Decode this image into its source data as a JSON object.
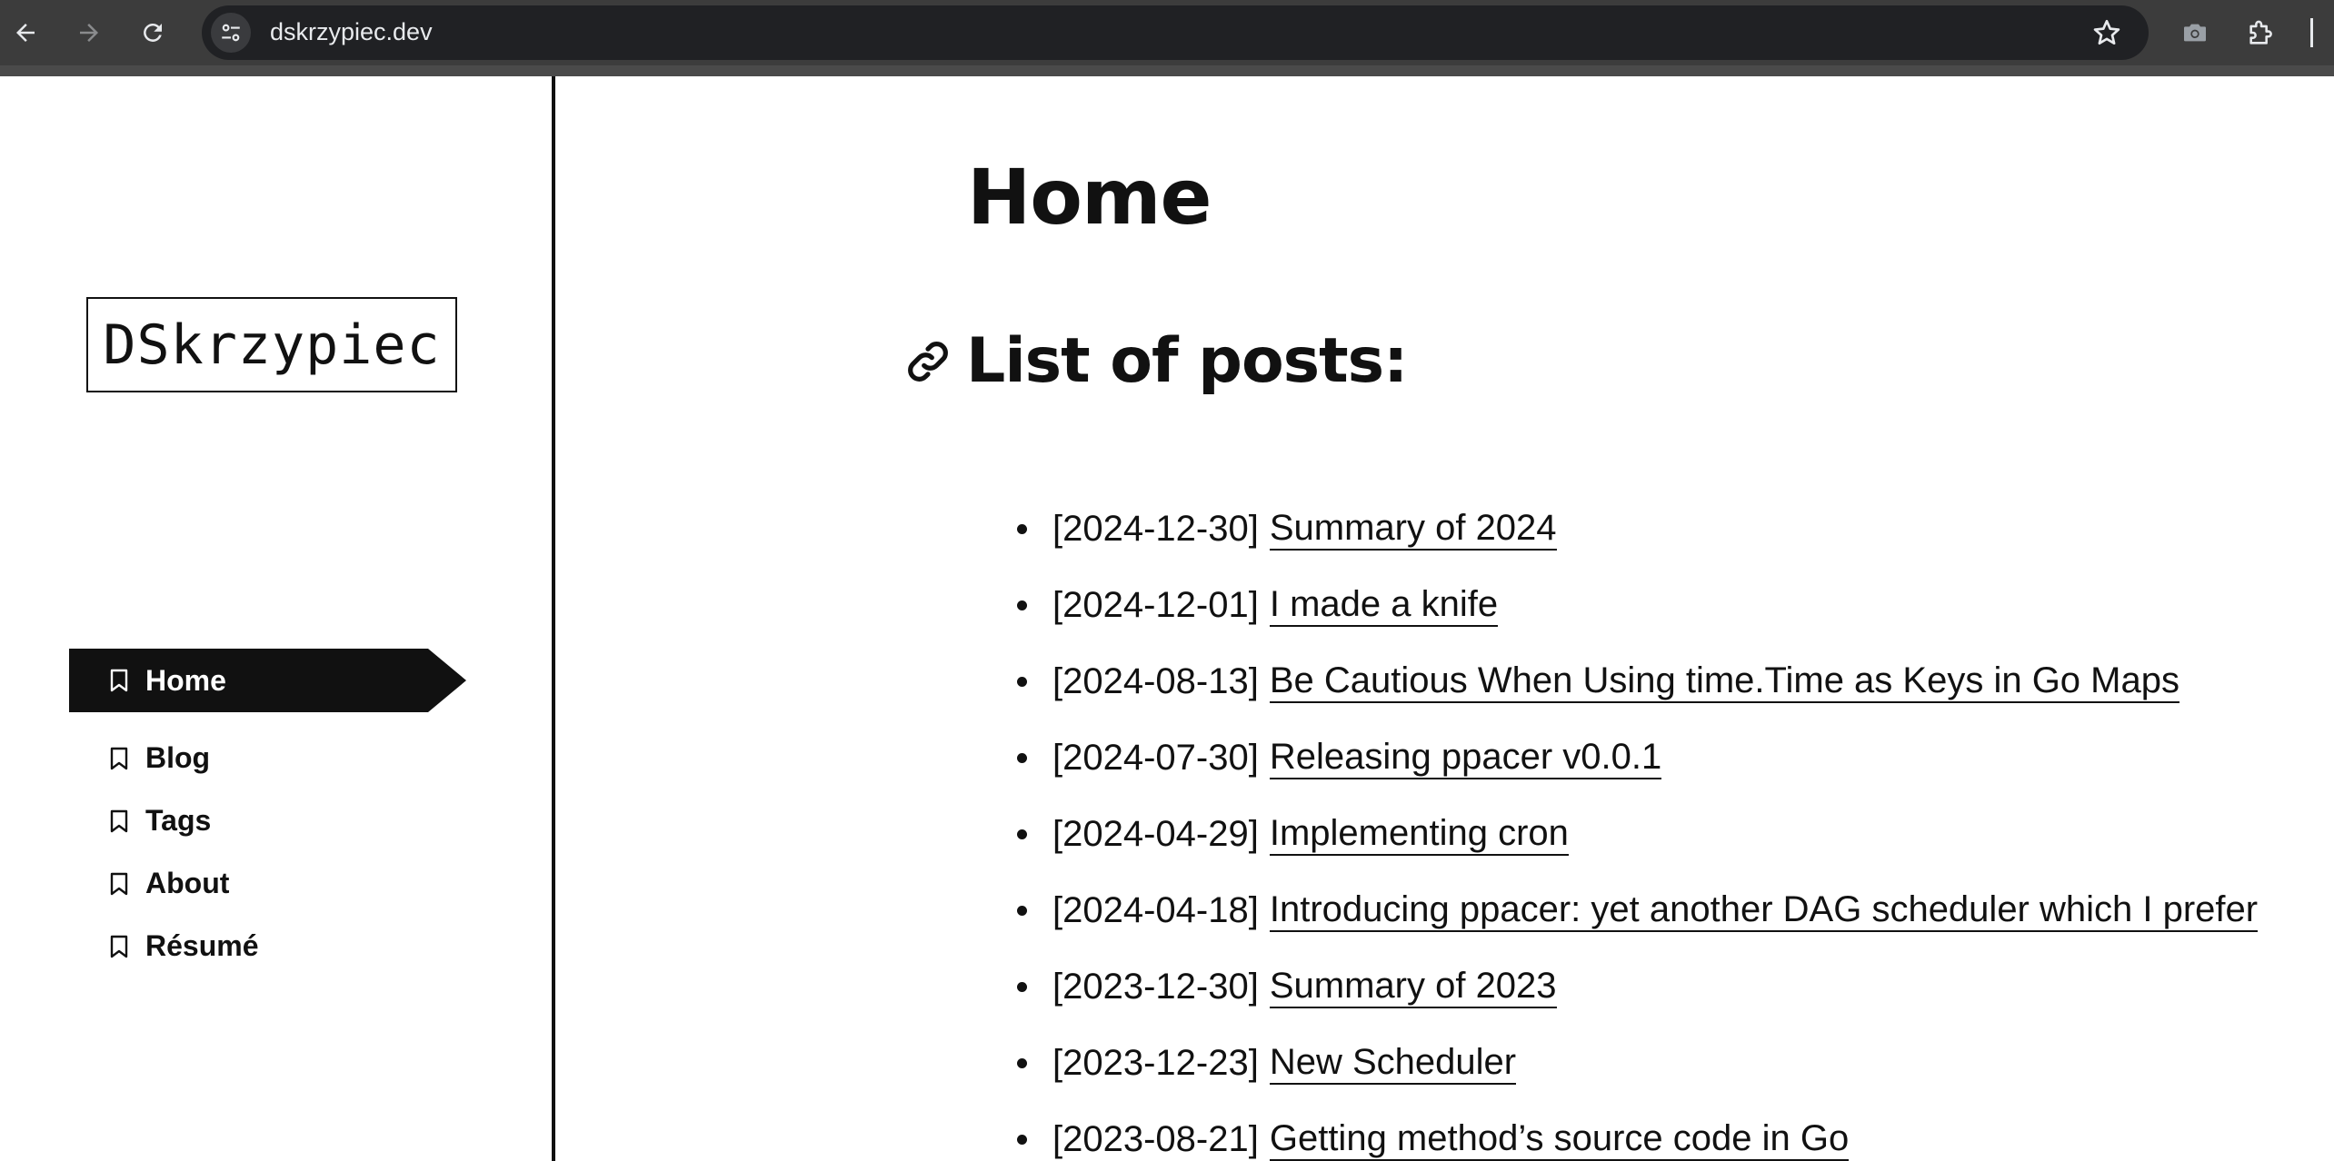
{
  "browser": {
    "url": "dskrzypiec.dev",
    "icons": {
      "back": "arrow-left-icon",
      "forward": "arrow-right-icon",
      "reload": "reload-icon",
      "site_info": "tune-icon",
      "bookmark": "star-icon",
      "screenshot": "camera-icon",
      "extensions": "puzzle-icon"
    }
  },
  "site": {
    "logo_text": "DSkrzypiec"
  },
  "menu": {
    "items": [
      {
        "label": "Home",
        "active": true
      },
      {
        "label": "Blog",
        "active": false
      },
      {
        "label": "Tags",
        "active": false
      },
      {
        "label": "About",
        "active": false
      },
      {
        "label": "Résumé",
        "active": false
      }
    ]
  },
  "main": {
    "title": "Home",
    "section_heading": "List of posts:",
    "posts": [
      {
        "date": "[2024-12-30]",
        "title": "Summary of 2024"
      },
      {
        "date": "[2024-12-01]",
        "title": "I made a knife"
      },
      {
        "date": "[2024-08-13]",
        "title": "Be Cautious When Using time.Time as Keys in Go Maps"
      },
      {
        "date": "[2024-07-30]",
        "title": "Releasing ppacer v0.0.1"
      },
      {
        "date": "[2024-04-29]",
        "title": "Implementing cron"
      },
      {
        "date": "[2024-04-18]",
        "title": "Introducing ppacer: yet another DAG scheduler which I prefer"
      },
      {
        "date": "[2023-12-30]",
        "title": "Summary of 2023"
      },
      {
        "date": "[2023-12-23]",
        "title": "New Scheduler"
      },
      {
        "date": "[2023-08-21]",
        "title": "Getting method’s source code in Go"
      }
    ]
  },
  "colors": {
    "chrome_bg": "#3c3c3c",
    "omnibox_bg": "#202124",
    "text": "#111111",
    "active_menu_bg": "#111111"
  }
}
